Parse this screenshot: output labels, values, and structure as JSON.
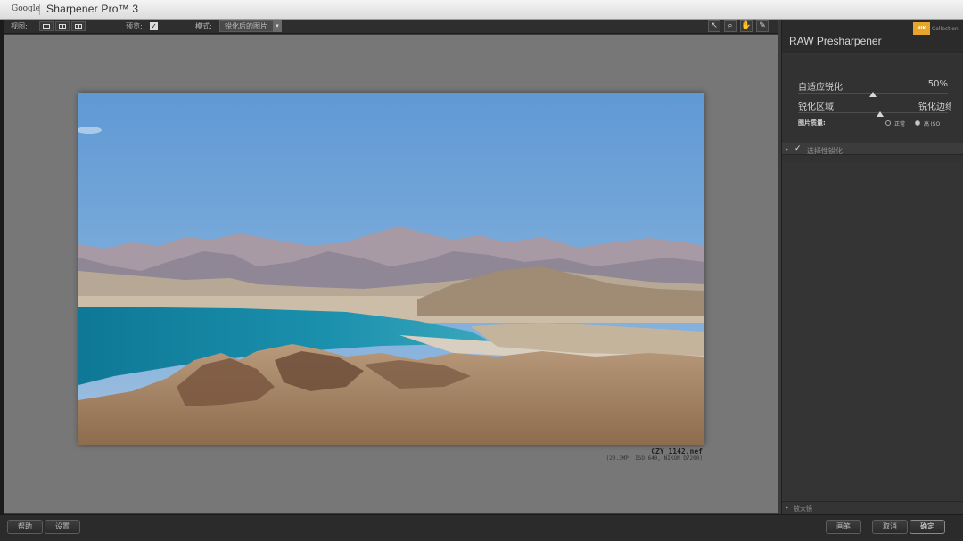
{
  "titlebar": {
    "brand": "Google",
    "app_name": "Sharpener Pro™ 3"
  },
  "toolbar": {
    "view_label": "视图:",
    "preview_label": "预览:",
    "preview_checked": "✓",
    "mode_label": "模式:",
    "mode_value": "锐化后的图片",
    "mode_arrow": "▾",
    "tool_icons": [
      "pointer-icon",
      "zoom-icon",
      "hand-icon",
      "eyedropper-icon"
    ],
    "tool_glyphs": [
      "↖",
      "⌕",
      "✋",
      "✎"
    ]
  },
  "image": {
    "file_name": "CZY_1142.nef",
    "file_meta": "(20.3MP, ISO 640, NIKON D7200)"
  },
  "panel": {
    "title": "RAW Presharpener",
    "logo_text": "NIK",
    "logo_sub": "Collection",
    "adaptive_label": "自适应锐化",
    "adaptive_value": "50%",
    "adaptive_level": 0.5,
    "area_label": "锐化区域",
    "area_value": "锐化边缘",
    "area_level": 0.55,
    "quality_label": "图片质量:",
    "quality_normal": "正常",
    "quality_high": "高 ISO",
    "selective_label": "选择性锐化",
    "selective_check": "✓",
    "loupe_label": "放大镜",
    "arrow_glyph": "▸"
  },
  "footer": {
    "help": "帮助",
    "settings": "设置",
    "brush": "画笔",
    "cancel": "取消",
    "ok": "确定"
  },
  "colors": {
    "canvas_bg": "#777777",
    "panel_bg": "#343434",
    "logo_accent": "#e8a52a"
  }
}
